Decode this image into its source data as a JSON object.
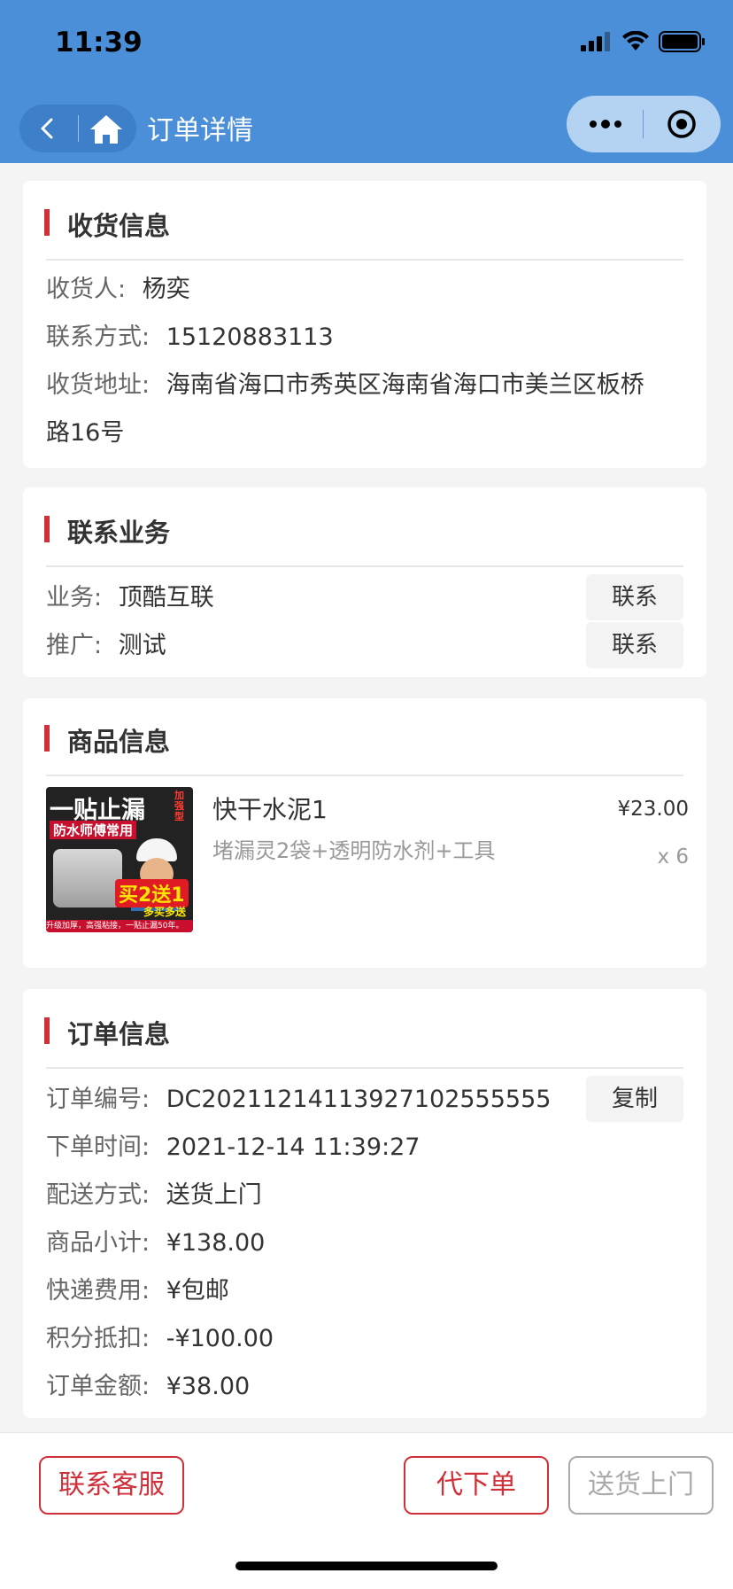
{
  "status": {
    "time": "11:39"
  },
  "nav": {
    "title": "订单详情"
  },
  "receiver": {
    "section_title": "收货信息",
    "name_label": "收货人:",
    "name": "杨奕",
    "phone_label": "联系方式:",
    "phone": "15120883113",
    "address_label": "收货地址:",
    "address_line1": "海南省海口市秀英区海南省海口市美兰区板桥",
    "address_line2": "路16号"
  },
  "contact": {
    "section_title": "联系业务",
    "rows": [
      {
        "label": "业务:",
        "value": "顶酷互联",
        "button": "联系"
      },
      {
        "label": "推广:",
        "value": "测试",
        "button": "联系"
      }
    ]
  },
  "product": {
    "section_title": "商品信息",
    "name": "快干水泥1",
    "spec": "堵漏灵2袋+透明防水剂+工具",
    "price": "¥23.00",
    "quantity": "x 6",
    "image": {
      "headline": "一贴止漏",
      "badge": "加强型",
      "subline": "防水师傅常用",
      "promo": "买2送1",
      "promo_sub": "多买多送",
      "footer": "升级加厚，高强粘接，一贴止漏50年。"
    }
  },
  "order": {
    "section_title": "订单信息",
    "copy_button": "复制",
    "rows": [
      {
        "label": "订单编号:",
        "value": "DC20211214113927102555555"
      },
      {
        "label": "下单时间:",
        "value": "2021-12-14 11:39:27"
      },
      {
        "label": "配送方式:",
        "value": "送货上门"
      },
      {
        "label": "商品小计:",
        "value": "¥138.00"
      },
      {
        "label": "快递费用:",
        "value": "¥包邮"
      },
      {
        "label": "积分抵扣:",
        "value": "-¥100.00"
      },
      {
        "label": "订单金额:",
        "value": "¥38.00"
      }
    ]
  },
  "bottom": {
    "service": "联系客服",
    "place_order": "代下单",
    "deliver": "送货上门"
  },
  "colors": {
    "header": "#4a8fd8",
    "accent": "#d0303a"
  }
}
